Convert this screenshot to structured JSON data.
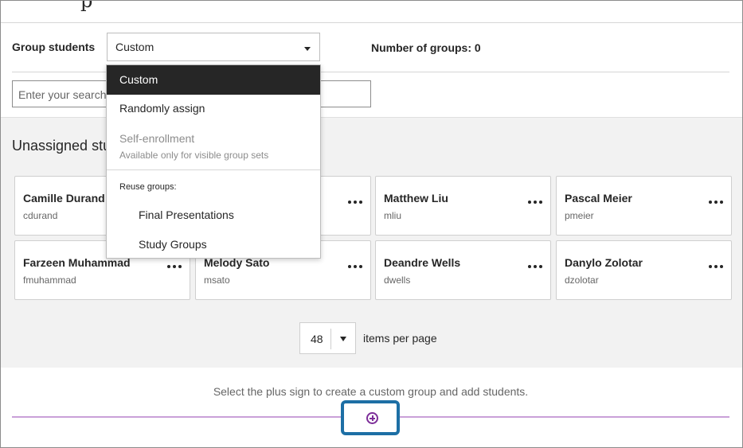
{
  "header": {
    "title_fragment": "p"
  },
  "grouping": {
    "label": "Group students",
    "selected": "Custom",
    "number_of_groups": "Number of groups: 0"
  },
  "search": {
    "placeholder": "Enter your search"
  },
  "unassigned": {
    "heading": "Unassigned students"
  },
  "students": [
    {
      "name": "Camille Durand",
      "username": "cdurand"
    },
    {
      "name": "",
      "username": ""
    },
    {
      "name": "Matthew Liu",
      "username": "mliu"
    },
    {
      "name": "Pascal Meier",
      "username": "pmeier"
    },
    {
      "name": "Farzeen Muhammad",
      "username": "fmuhammad"
    },
    {
      "name": "Melody Sato",
      "username": "msato"
    },
    {
      "name": "Deandre Wells",
      "username": "dwells"
    },
    {
      "name": "Danylo Zolotar",
      "username": "dzolotar"
    }
  ],
  "pagination": {
    "per_page": "48",
    "label": "items per page"
  },
  "custom_group": {
    "hint": "Select the plus sign to create a custom group and add students."
  },
  "dropdown": {
    "options": [
      "Custom",
      "Randomly assign",
      "Self-enrollment"
    ],
    "self_enrollment_note": "Available only for visible group sets",
    "reuse_label": "Reuse groups:",
    "reuse_groups": [
      "Final Presentations",
      "Study Groups"
    ]
  },
  "icons": {
    "more": "more-options-icon",
    "add": "add-circle-icon",
    "caret": "chevron-down-icon"
  },
  "colors": {
    "accent_purple": "#7d2e99",
    "highlight_blue": "#1d6fa5",
    "selected_bg": "#262626"
  }
}
